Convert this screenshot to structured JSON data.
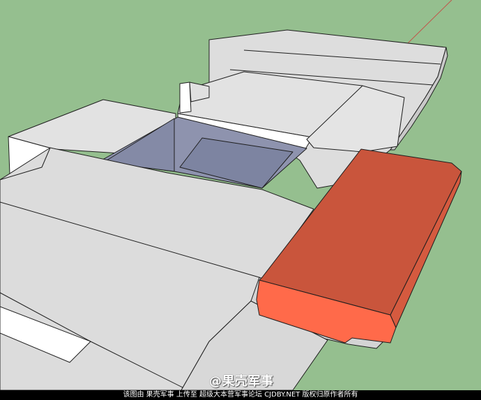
{
  "colors": {
    "ground": "#95bf8f",
    "roof_light": "#e4e4e4",
    "roof_mid": "#d6d6d6",
    "wall_white": "#ffffff",
    "courtyard": "#8e93ae",
    "courtyard_dark": "#7e84a2",
    "block_top": "#c9553c",
    "block_front": "#ff6a4a",
    "edge": "#202020"
  },
  "watermark": "@果壳军事",
  "caption": "该图由 果壳军事 上传至 超级大本营军事论坛 CJDBY.NET 版权归原作者所有"
}
